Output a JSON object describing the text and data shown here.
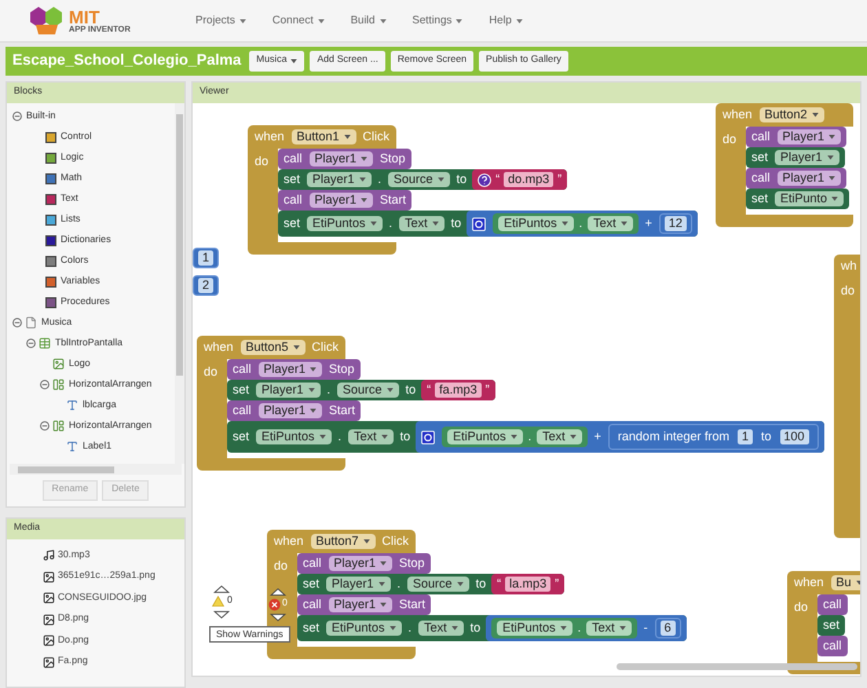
{
  "logo": {
    "title": "MIT",
    "subtitle": "APP INVENTOR"
  },
  "menu": [
    "Projects",
    "Connect",
    "Build",
    "Settings",
    "Help"
  ],
  "project": {
    "title": "Escape_School_Colegio_Palma",
    "buttons": [
      {
        "label": "Musica",
        "kind": "dropdown"
      },
      {
        "label": "Add Screen ...",
        "kind": "button"
      },
      {
        "label": "Remove Screen",
        "kind": "button"
      },
      {
        "label": "Publish to Gallery",
        "kind": "button"
      }
    ]
  },
  "blocks_panel": {
    "title": "Blocks",
    "tree": [
      {
        "label": "Built-in",
        "kind": "folder",
        "expanded": true,
        "children": [
          {
            "label": "Control",
            "kind": "category",
            "color": "#d9a62e"
          },
          {
            "label": "Logic",
            "kind": "category",
            "color": "#74a83c"
          },
          {
            "label": "Math",
            "kind": "category",
            "color": "#3f72b6"
          },
          {
            "label": "Text",
            "kind": "category",
            "color": "#b8285c"
          },
          {
            "label": "Lists",
            "kind": "category",
            "color": "#4aa8d8"
          },
          {
            "label": "Dictionaries",
            "kind": "category",
            "color": "#2a1a9a"
          },
          {
            "label": "Colors",
            "kind": "category",
            "color": "#7d7d7d"
          },
          {
            "label": "Variables",
            "kind": "category",
            "color": "#d2602c"
          },
          {
            "label": "Procedures",
            "kind": "category",
            "color": "#7b5386"
          }
        ]
      },
      {
        "label": "Musica",
        "kind": "screen",
        "expanded": true,
        "children": [
          {
            "label": "TblIntroPantalla",
            "kind": "table",
            "expanded": true,
            "children": [
              {
                "label": "Logo",
                "kind": "image"
              },
              {
                "label": "HorizontalArrangen",
                "kind": "arrangement",
                "expanded": true,
                "children": [
                  {
                    "label": "lblcarga",
                    "kind": "label"
                  }
                ]
              },
              {
                "label": "HorizontalArrangen",
                "kind": "arrangement",
                "expanded": true,
                "children": [
                  {
                    "label": "Label1",
                    "kind": "label"
                  }
                ]
              }
            ]
          }
        ]
      }
    ],
    "buttons": [
      {
        "label": "Rename",
        "disabled": true
      },
      {
        "label": "Delete",
        "disabled": true
      }
    ]
  },
  "media": {
    "title": "Media",
    "files": [
      {
        "name": "30.mp3",
        "kind": "audio"
      },
      {
        "name": "3651e91c…259a1.png",
        "kind": "image"
      },
      {
        "name": "CONSEGUIDOO.jpg",
        "kind": "image"
      },
      {
        "name": "D8.png",
        "kind": "image"
      },
      {
        "name": "Do.png",
        "kind": "image"
      },
      {
        "name": "Fa.png",
        "kind": "image"
      }
    ]
  },
  "viewer": {
    "title": "Viewer",
    "blocks": [
      {
        "kind": "event",
        "when": "when",
        "component": "Button1",
        "event": "Click",
        "do": "do",
        "statements": [
          {
            "kind": "call",
            "keyword": "call",
            "component": "Player1",
            "method": "Stop"
          },
          {
            "kind": "set",
            "keyword": "set",
            "component": "Player1",
            "dot": ".",
            "property": "Source",
            "to": "to",
            "value": {
              "kind": "text",
              "help": true,
              "open": "“",
              "text": "do.mp3",
              "close": "”"
            }
          },
          {
            "kind": "call",
            "keyword": "call",
            "component": "Player1",
            "method": "Start"
          },
          {
            "kind": "set",
            "keyword": "set",
            "component": "EtiPuntos",
            "dot": ".",
            "property": "Text",
            "to": "to",
            "value": {
              "kind": "math",
              "mutator": true,
              "op": "+",
              "left": {
                "kind": "getter",
                "component": "EtiPuntos",
                "dot": ".",
                "property": "Text"
              },
              "right": {
                "kind": "number",
                "text": "12"
              }
            }
          }
        ]
      },
      {
        "kind": "number",
        "text": "1"
      },
      {
        "kind": "number",
        "text": "2"
      },
      {
        "kind": "event",
        "when": "when",
        "component": "Button5",
        "event": "Click",
        "do": "do",
        "statements": [
          {
            "kind": "call",
            "keyword": "call",
            "component": "Player1",
            "method": "Stop"
          },
          {
            "kind": "set",
            "keyword": "set",
            "component": "Player1",
            "dot": ".",
            "property": "Source",
            "to": "to",
            "value": {
              "kind": "text",
              "help": false,
              "open": "“",
              "text": "fa.mp3",
              "close": "”"
            }
          },
          {
            "kind": "call",
            "keyword": "call",
            "component": "Player1",
            "method": "Start"
          },
          {
            "kind": "set",
            "keyword": "set",
            "component": "EtiPuntos",
            "dot": ".",
            "property": "Text",
            "to": "to",
            "value": {
              "kind": "math",
              "mutator": true,
              "op": "+",
              "left": {
                "kind": "getter",
                "component": "EtiPuntos",
                "dot": ".",
                "property": "Text"
              },
              "right": {
                "kind": "random",
                "label": "random integer from",
                "from": "1",
                "to_label": "to",
                "to": "100"
              }
            }
          }
        ]
      },
      {
        "kind": "event",
        "when": "when",
        "component": "Button7",
        "event": "Click",
        "do": "do",
        "statements": [
          {
            "kind": "call",
            "keyword": "call",
            "component": "Player1",
            "method": "Stop"
          },
          {
            "kind": "set",
            "keyword": "set",
            "component": "Player1",
            "dot": ".",
            "property": "Source",
            "to": "to",
            "value": {
              "kind": "text",
              "help": false,
              "open": "“",
              "text": "la.mp3",
              "close": "”"
            }
          },
          {
            "kind": "call",
            "keyword": "call",
            "component": "Player1",
            "method": "Start"
          },
          {
            "kind": "set",
            "keyword": "set",
            "component": "EtiPuntos",
            "dot": ".",
            "property": "Text",
            "to": "to",
            "value": {
              "kind": "math",
              "mutator": false,
              "op": "-",
              "left": {
                "kind": "getter",
                "component": "EtiPuntos",
                "dot": ".",
                "property": "Text"
              },
              "right": {
                "kind": "number",
                "text": "6"
              }
            }
          }
        ]
      },
      {
        "kind": "event",
        "when": "when",
        "component": "Button2",
        "do": "do",
        "statements": [
          {
            "kind": "call",
            "keyword": "call",
            "component": "Player1"
          },
          {
            "kind": "set",
            "keyword": "set",
            "component": "Player1"
          },
          {
            "kind": "call",
            "keyword": "call",
            "component": "Player1"
          },
          {
            "kind": "set",
            "keyword": "set",
            "component": "EtiPunto"
          }
        ]
      },
      {
        "kind": "event",
        "when": "wh",
        "do": "do"
      },
      {
        "kind": "event",
        "when": "when",
        "component": "Bu",
        "do": "do",
        "statements": [
          {
            "kind": "call",
            "keyword": "call"
          },
          {
            "kind": "set",
            "keyword": "set"
          },
          {
            "kind": "call",
            "keyword": "call"
          }
        ]
      }
    ],
    "warnings": {
      "warning_count": "0",
      "error_count": "0",
      "toggle": "Show Warnings"
    }
  }
}
